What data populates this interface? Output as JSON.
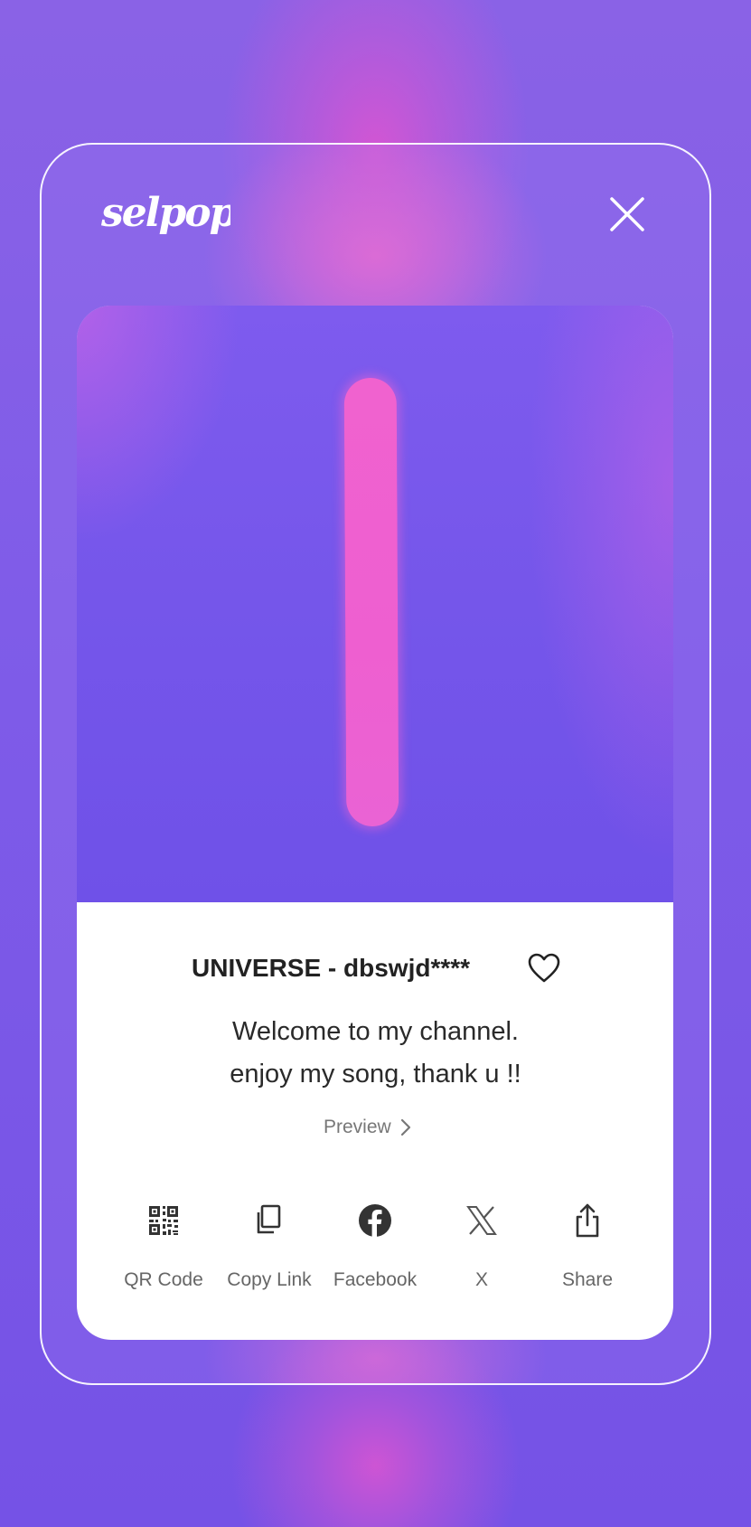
{
  "app": {
    "logo_text": "selpop",
    "close_icon": "close-icon"
  },
  "track": {
    "title": "UNIVERSE - dbswjd****",
    "favorite_icon": "heart-icon",
    "description_line1": "Welcome to my channel.",
    "description_line2": "enjoy my song, thank u !!",
    "preview_label": "Preview"
  },
  "share_options": [
    {
      "label": "QR Code",
      "icon": "qr-code-icon"
    },
    {
      "label": "Copy Link",
      "icon": "copy-icon"
    },
    {
      "label": "Facebook",
      "icon": "facebook-icon"
    },
    {
      "label": "X",
      "icon": "x-logo-icon"
    },
    {
      "label": "Share",
      "icon": "share-icon"
    }
  ],
  "colors": {
    "background": "#7b55e6",
    "accent_pink": "#ee5fd0",
    "card_background": "#ffffff"
  }
}
